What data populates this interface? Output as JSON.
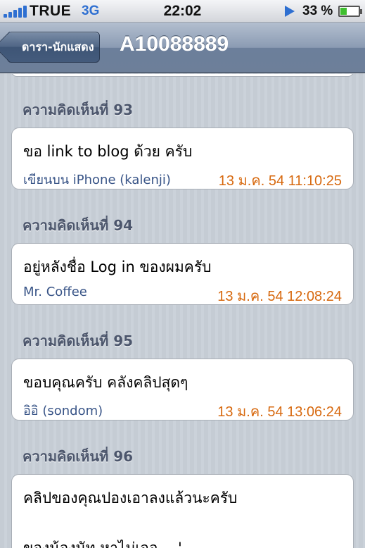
{
  "status": {
    "carrier": "TRUE",
    "network": "3G",
    "time": "22:02",
    "battery_text": "33 %",
    "battery_level": 0.33
  },
  "nav": {
    "back_label": "ดารา-นักแสดง",
    "title": "A10088889"
  },
  "comments": [
    {
      "header": "ความคิดเห็นที่ 93",
      "body": "ขอ link to blog ด้วย ครับ",
      "author": "เขียนบน iPhone (kalenji)",
      "time": "13 ม.ค. 54 11:10:25"
    },
    {
      "header": "ความคิดเห็นที่ 94",
      "body": "อยู่หลังชื่อ Log in ของผมครับ",
      "author": "Mr. Coffee",
      "time": "13 ม.ค. 54 12:08:24"
    },
    {
      "header": "ความคิดเห็นที่ 95",
      "body": "ขอบคุณครับ คลังคลิปสุดๆ",
      "author": "อิอิ (sondom)",
      "time": "13 ม.ค. 54 13:06:24"
    },
    {
      "header": "ความคิดเห็นที่ 96",
      "body": "คลิปของคุณปองเอาลงแล้วนะครับ",
      "body2": "ของน้องนัท หาไม่เจอ -   -'"
    }
  ]
}
